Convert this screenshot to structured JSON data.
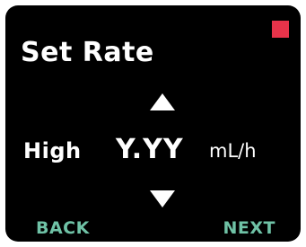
{
  "screen": {
    "title": "Set Rate",
    "status_indicator_color": "#e8334a"
  },
  "rate": {
    "level": "High",
    "value": "Y.YY",
    "unit": "mL/h",
    "increase_icon": "triangle-up-icon",
    "decrease_icon": "triangle-down-icon"
  },
  "softkeys": {
    "back_label": "BACK",
    "next_label": "NEXT",
    "color": "#6fc2a6"
  }
}
